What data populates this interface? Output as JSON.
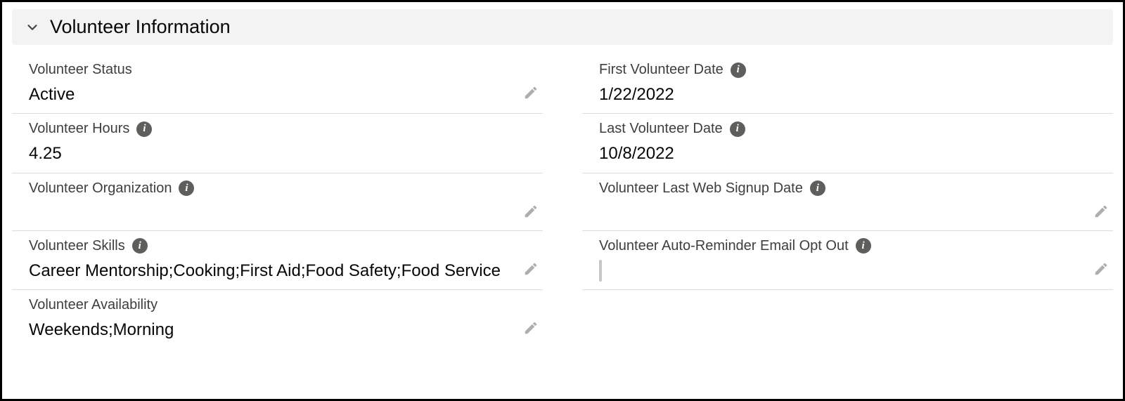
{
  "section": {
    "title": "Volunteer Information"
  },
  "left": {
    "status": {
      "label": "Volunteer Status",
      "value": "Active",
      "info": false,
      "editable": true
    },
    "hours": {
      "label": "Volunteer Hours",
      "value": "4.25",
      "info": true,
      "editable": false
    },
    "organization": {
      "label": "Volunteer Organization",
      "value": "",
      "info": true,
      "editable": true
    },
    "skills": {
      "label": "Volunteer Skills",
      "value": "Career Mentorship;Cooking;First Aid;Food Safety;Food Service",
      "info": true,
      "editable": true
    },
    "availability": {
      "label": "Volunteer Availability",
      "value": "Weekends;Morning",
      "info": false,
      "editable": true
    }
  },
  "right": {
    "first_date": {
      "label": "First Volunteer Date",
      "value": "1/22/2022",
      "info": true,
      "editable": false
    },
    "last_date": {
      "label": "Last Volunteer Date",
      "value": "10/8/2022",
      "info": true,
      "editable": false
    },
    "last_signup": {
      "label": "Volunteer Last Web Signup Date",
      "value": "",
      "info": true,
      "editable": true
    },
    "optout": {
      "label": "Volunteer Auto-Reminder Email Opt Out",
      "checked": false,
      "info": true,
      "editable": true
    }
  }
}
